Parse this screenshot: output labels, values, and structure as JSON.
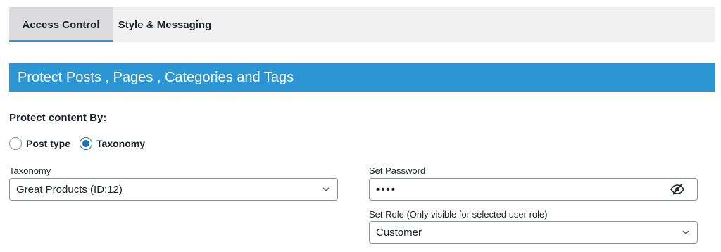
{
  "tabs": [
    {
      "label": "Access Control",
      "active": true
    },
    {
      "label": "Style & Messaging",
      "active": false
    }
  ],
  "banner": {
    "title": "Protect Posts , Pages , Categories and Tags"
  },
  "protect": {
    "label": "Protect content By:",
    "options": [
      {
        "label": "Post type",
        "checked": false
      },
      {
        "label": "Taxonomy",
        "checked": true
      }
    ]
  },
  "taxonomy": {
    "label": "Taxonomy",
    "value": "Great Products (ID:12)"
  },
  "password": {
    "label": "Set Password",
    "value": "••••"
  },
  "role": {
    "label": "Set Role (Only visible for selected user role)",
    "value": "Customer"
  },
  "colors": {
    "accent": "#2c95d4",
    "radio": "#2271b1"
  },
  "icons": {
    "select": "chevron-down-icon",
    "password_toggle": "eye-slash-icon"
  }
}
